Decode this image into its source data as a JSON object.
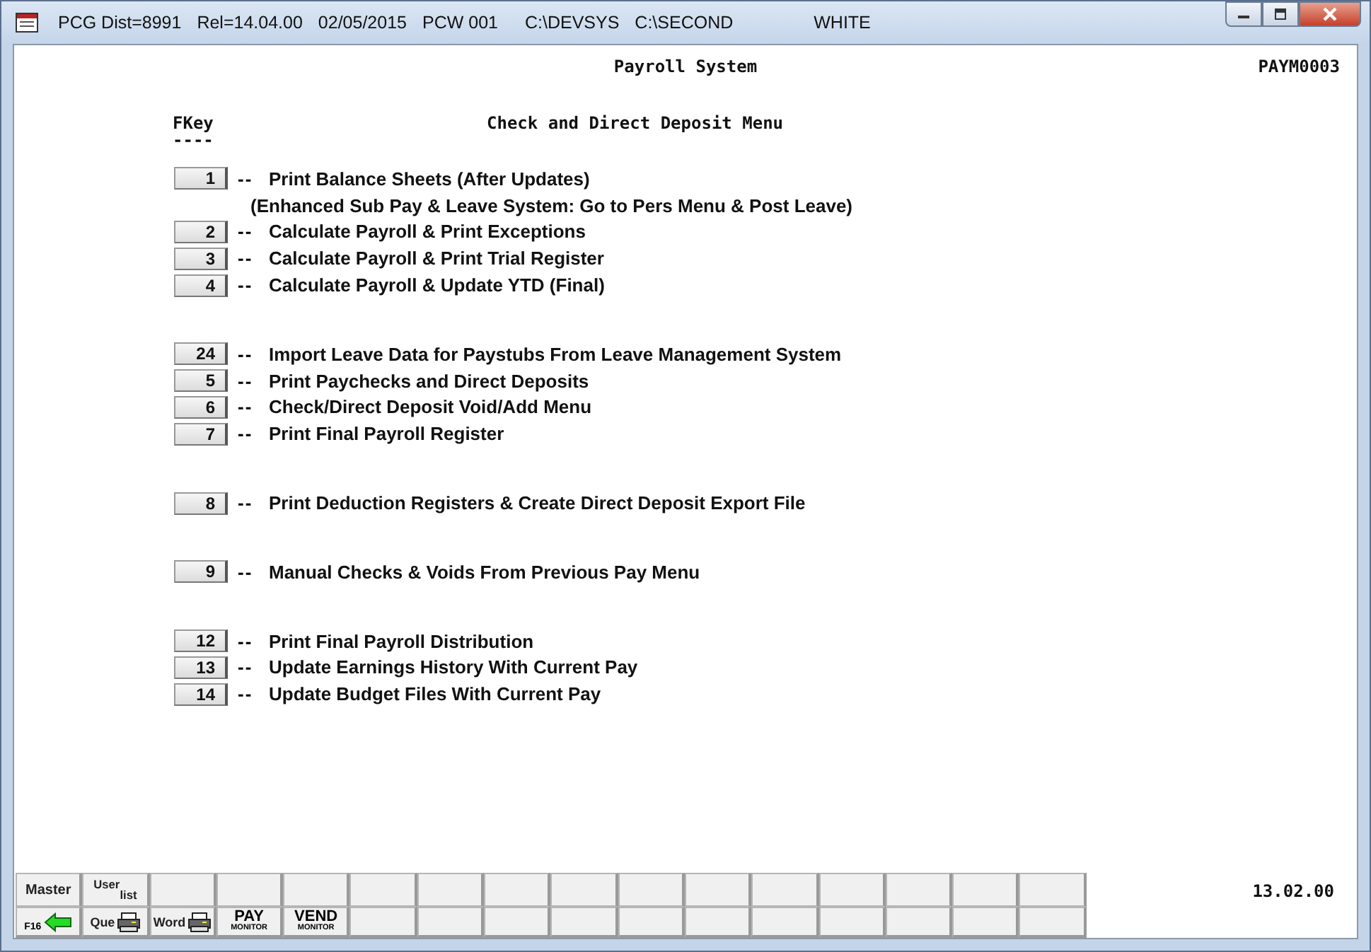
{
  "window": {
    "title_parts": [
      "PCG Dist=8991",
      "Rel=14.04.00",
      "02/05/2015",
      "PCW 001",
      "C:\\DEVSYS",
      "C:\\SECOND",
      "WHITE"
    ]
  },
  "header": {
    "system": "Payroll System",
    "screen_id": "PAYM0003"
  },
  "menu": {
    "fkey_heading": "FKey",
    "underline": "----",
    "title": "Check and Direct Deposit Menu",
    "separator": "--",
    "groups": [
      {
        "items": [
          {
            "key": "1",
            "label": "Print Balance Sheets (After Updates)",
            "note": "(Enhanced Sub Pay & Leave System:  Go to Pers Menu & Post Leave)"
          },
          {
            "key": "2",
            "label": "Calculate Payroll & Print Exceptions"
          },
          {
            "key": "3",
            "label": "Calculate Payroll & Print Trial Register"
          },
          {
            "key": "4",
            "label": "Calculate Payroll & Update YTD (Final)"
          }
        ]
      },
      {
        "items": [
          {
            "key": "24",
            "label": "Import Leave Data for Paystubs From Leave Management System"
          },
          {
            "key": "5",
            "label": "Print Paychecks and Direct Deposits"
          },
          {
            "key": "6",
            "label": "Check/Direct Deposit  Void/Add Menu"
          },
          {
            "key": "7",
            "label": "Print Final Payroll Register"
          }
        ]
      },
      {
        "items": [
          {
            "key": "8",
            "label": "Print Deduction Registers & Create Direct Deposit Export File"
          }
        ]
      },
      {
        "items": [
          {
            "key": "9",
            "label": "Manual Checks & Voids From Previous Pay Menu"
          }
        ]
      },
      {
        "items": [
          {
            "key": "12",
            "label": "Print Final Payroll Distribution"
          },
          {
            "key": "13",
            "label": "Update Earnings History With Current Pay"
          },
          {
            "key": "14",
            "label": "Update Budget Files With Current Pay"
          }
        ]
      }
    ]
  },
  "function_bar": {
    "rows": [
      [
        {
          "kind": "text",
          "label": "Master"
        },
        {
          "kind": "text",
          "label": "$^{User}$$_{list}$"
        },
        {
          "kind": "empty"
        },
        {
          "kind": "empty"
        },
        {
          "kind": "empty"
        },
        {
          "kind": "empty"
        },
        {
          "kind": "empty"
        },
        {
          "kind": "empty"
        },
        {
          "kind": "empty"
        },
        {
          "kind": "empty"
        },
        {
          "kind": "empty"
        },
        {
          "kind": "empty"
        },
        {
          "kind": "empty"
        },
        {
          "kind": "empty"
        },
        {
          "kind": "empty"
        },
        {
          "kind": "empty"
        }
      ],
      [
        {
          "kind": "back",
          "label": "F16"
        },
        {
          "kind": "printer",
          "label": "Que"
        },
        {
          "kind": "printer",
          "label": "Word"
        },
        {
          "kind": "monitor",
          "big": "PAY",
          "small": "MONITOR"
        },
        {
          "kind": "monitor",
          "big": "VEND",
          "small": "MONITOR"
        },
        {
          "kind": "empty"
        },
        {
          "kind": "empty"
        },
        {
          "kind": "empty"
        },
        {
          "kind": "empty"
        },
        {
          "kind": "empty"
        },
        {
          "kind": "empty"
        },
        {
          "kind": "empty"
        },
        {
          "kind": "empty"
        },
        {
          "kind": "empty"
        },
        {
          "kind": "empty"
        },
        {
          "kind": "empty"
        }
      ]
    ],
    "version": "13.02.00"
  }
}
